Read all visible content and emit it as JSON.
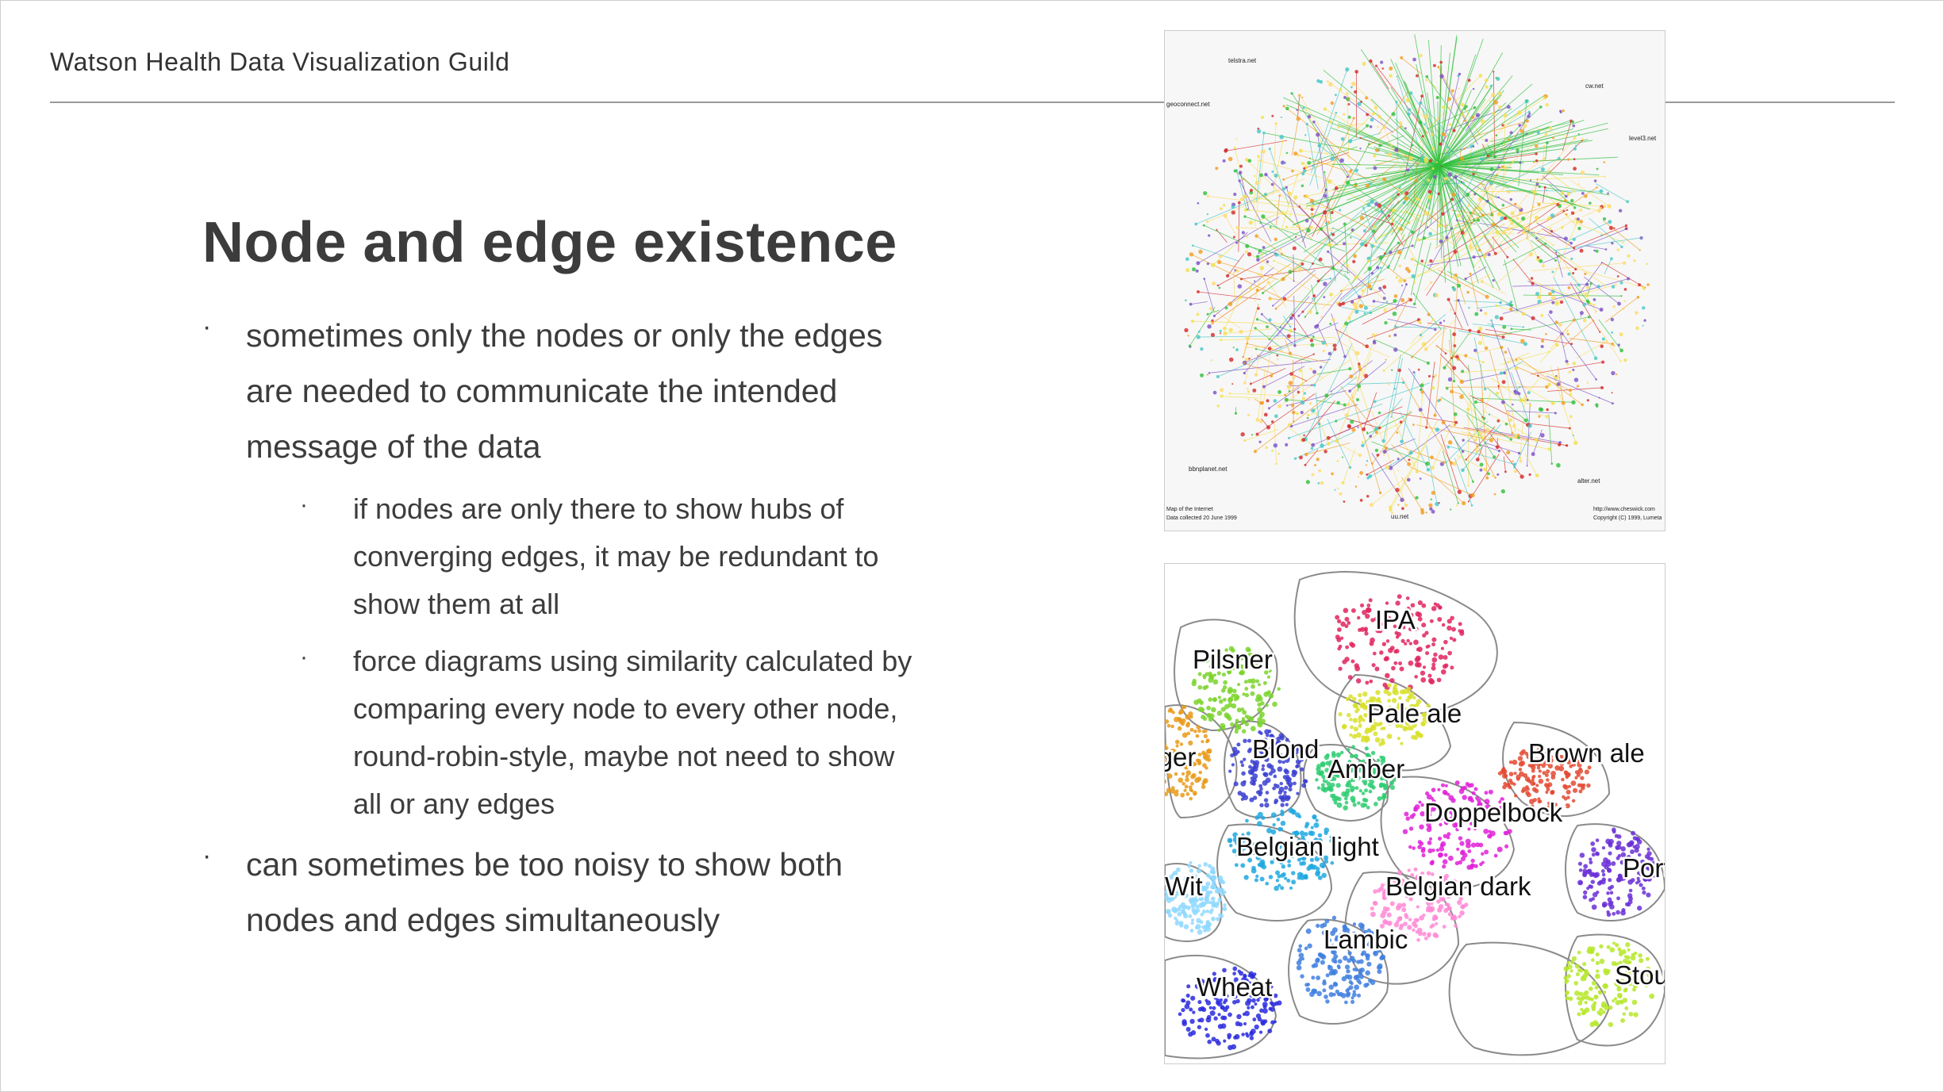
{
  "header": {
    "guild": "Watson Health Data Visualization Guild"
  },
  "slide": {
    "title": "Node and edge existence",
    "bullet_symbol": "·",
    "bullets": [
      {
        "text": "sometimes only the nodes or only the edges are needed to communicate the intended message of the data",
        "lines": [
          "sometimes only the nodes or only the edges",
          "are needed to communicate the intended",
          "message of the data"
        ],
        "sub": [
          {
            "lines": [
              "if nodes are only there to show hubs of",
              "converging edges, it may be redundant to",
              "show them at all"
            ]
          },
          {
            "lines": [
              "force diagrams using similarity calculated by",
              "comparing every node to every other node,",
              "round-robin-style, maybe not need to show",
              "all or any edges"
            ]
          }
        ]
      },
      {
        "lines": [
          "can sometimes be too noisy to show both",
          "nodes and edges simultaneously"
        ]
      }
    ]
  },
  "images": {
    "internet_map": {
      "labels": [
        "telstra.net",
        "cw.net",
        "geoconnect.net",
        "level3.net",
        "bbnplanet.net",
        "uu.net",
        "alter.net",
        "Map of the Internet",
        "Data collected 20 June 1999",
        "http://www.cheswick.com",
        "Copyright (C) 1999, Lumeta"
      ],
      "hub_color": "#2fbf3a",
      "colors": [
        "#f4e04a",
        "#d62728",
        "#2fbf3a",
        "#f29b1d",
        "#7a4fc6",
        "#43c6c6",
        "#ffd966"
      ]
    },
    "beer_map": {
      "labels": [
        "IPA",
        "Pilsner",
        "Pale ale",
        "Lager",
        "Blond",
        "Amber",
        "Brown ale",
        "Doppelbock",
        "Belgian light",
        "Wit",
        "Belgian dark",
        "Porter",
        "Lambic",
        "Wheat",
        "Stout"
      ],
      "colors": {
        "IPA": "#e0245e",
        "Pilsner": "#7ad32b",
        "Pale ale": "#d8e02a",
        "Lager": "#e89a1a",
        "Blond": "#3a3fd0",
        "Amber": "#2ecc71",
        "Brown ale": "#e34a33",
        "Doppelbock": "#e020d8",
        "Belgian light": "#20a8e0",
        "Wit": "#8fd8ff",
        "Belgian dark": "#ff8ad6",
        "Porter": "#6a2fd6",
        "Lambic": "#3f7fe0",
        "Wheat": "#2a2adf",
        "Stout": "#b6e82a"
      }
    }
  }
}
